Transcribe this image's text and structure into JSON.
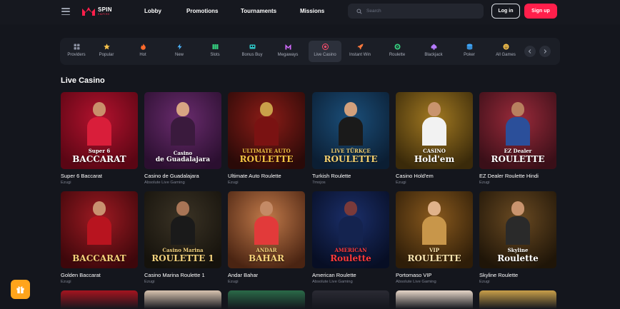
{
  "header": {
    "logo_text": "SPIN",
    "logo_subtext": "EMPIRE",
    "nav": [
      "Lobby",
      "Promotions",
      "Tournaments",
      "Missions"
    ],
    "search_placeholder": "Search",
    "login_label": "Log in",
    "signup_label": "Sign up"
  },
  "categories": [
    {
      "label": "Providers",
      "icon": "grid-icon",
      "color": "#8a90a0"
    },
    {
      "label": "Popular",
      "icon": "star-icon",
      "color": "#f5c04a"
    },
    {
      "label": "Hot",
      "icon": "fire-icon",
      "color": "#ff6a2b"
    },
    {
      "label": "New",
      "icon": "lightning-icon",
      "color": "#4db6ff"
    },
    {
      "label": "Slots",
      "icon": "slots-icon",
      "color": "#35d07f"
    },
    {
      "label": "Bonus Buy",
      "icon": "bonus-buy-icon",
      "color": "#2ec4c4"
    },
    {
      "label": "Megaways",
      "icon": "megaways-icon",
      "color": "#d36bff"
    },
    {
      "label": "Live Casino",
      "icon": "live-casino-icon",
      "color": "#ff4d6d",
      "active": true
    },
    {
      "label": "Instant Win",
      "icon": "rocket-icon",
      "color": "#ff7a3d"
    },
    {
      "label": "Roulette",
      "icon": "roulette-icon",
      "color": "#35d07f"
    },
    {
      "label": "Blackjack",
      "icon": "blackjack-icon",
      "color": "#b57bff"
    },
    {
      "label": "Poker",
      "icon": "poker-icon",
      "color": "#3fa9ff"
    },
    {
      "label": "All Games",
      "icon": "all-games-icon",
      "color": "#f5c04a"
    }
  ],
  "section_title": "Live Casino",
  "games": [
    {
      "title": "Super 6 Baccarat",
      "provider": "Ezugi",
      "logo_line1": "Super 6",
      "logo_line2": "BACCARAT",
      "bg": "#b3122e",
      "bg2": "#5a0614",
      "skin": "#c98f6b",
      "outfit": "#d91e3a",
      "logo_color": "#ffffff"
    },
    {
      "title": "Casino de Guadalajara",
      "provider": "Absolute Live Gaming",
      "logo_line1": "Casino",
      "logo_line2": "de Guadalajara",
      "bg": "#6a2c6e",
      "bg2": "#2b0f30",
      "skin": "#d7a583",
      "outfit": "#3a1a3d",
      "logo_color": "#ffffff"
    },
    {
      "title": "Ultimate Auto Roulette",
      "provider": "Ezugi",
      "logo_line1": "ULTIMATE AUTO",
      "logo_line2": "ROULETTE",
      "bg": "#8c1c17",
      "bg2": "#2a0a08",
      "skin": "#c9a04a",
      "outfit": "#7a1212",
      "logo_color": "#f6c443"
    },
    {
      "title": "Turkish Roulette",
      "provider": "7mojos",
      "logo_line1": "LIVE TÜRKÇE",
      "logo_line2": "ROULETTE",
      "bg": "#1b4f7a",
      "bg2": "#0b1e33",
      "skin": "#d2a07c",
      "outfit": "#1a1a1a",
      "logo_color": "#f4d06f"
    },
    {
      "title": "Casino Hold'em",
      "provider": "Ezugi",
      "logo_line1": "CASINO",
      "logo_line2": "Hold'em",
      "bg": "#a37a22",
      "bg2": "#3a2a0a",
      "skin": "#c9946e",
      "outfit": "#f2f2f2",
      "logo_color": "#ffffff"
    },
    {
      "title": "EZ Dealer Roulette Hindi",
      "provider": "Ezugi",
      "logo_line1": "EZ Dealer",
      "logo_line2": "ROULETTE",
      "bg": "#9a2a3a",
      "bg2": "#3a0f18",
      "skin": "#b8805f",
      "outfit": "#2b4f9a",
      "logo_color": "#ffffff"
    },
    {
      "title": "Golden Baccarat",
      "provider": "Ezugi",
      "logo_line1": "",
      "logo_line2": "BACCARAT",
      "bg": "#9e1a22",
      "bg2": "#3d070b",
      "skin": "#c99170",
      "outfit": "#b8141f",
      "logo_color": "#f6d27a"
    },
    {
      "title": "Casino Marina Roulette 1",
      "provider": "Ezugi",
      "logo_line1": "Casino Marina",
      "logo_line2": "ROULETTE 1",
      "bg": "#3b3325",
      "bg2": "#15120c",
      "skin": "#a87556",
      "outfit": "#1a1a1a",
      "logo_color": "#f3d27d"
    },
    {
      "title": "Andar Bahar",
      "provider": "Ezugi",
      "logo_line1": "ANDAR",
      "logo_line2": "BAHAR",
      "bg": "#c27a4a",
      "bg2": "#4a2412",
      "skin": "#c48a66",
      "outfit": "#e23a3a",
      "logo_color": "#f6d27a"
    },
    {
      "title": "American Roulette",
      "provider": "Absolute Live Gaming",
      "logo_line1": "AMERICAN",
      "logo_line2": "Roulette",
      "bg": "#1b2f6a",
      "bg2": "#070e24",
      "skin": "#7a3a3a",
      "outfit": "#14234f",
      "logo_color": "#ff3a3a"
    },
    {
      "title": "Portomaso VIP",
      "provider": "Absolute Live Gaming",
      "logo_line1": "VIP",
      "logo_line2": "ROULETTE",
      "bg": "#8a5a1e",
      "bg2": "#2e1d08",
      "skin": "#e0b28a",
      "outfit": "#c8964a",
      "logo_color": "#fbe6b0"
    },
    {
      "title": "Skyline Roulette",
      "provider": "Ezugi",
      "logo_line1": "Skyline",
      "logo_line2": "Roulette",
      "bg": "#6a4a22",
      "bg2": "#1f1508",
      "skin": "#c9946e",
      "outfit": "#2a2a2a",
      "logo_color": "#ffffff"
    }
  ],
  "partial_row_colors": [
    "#a5141f",
    "#d9c4b0",
    "#2a6a48",
    "#2a2a33",
    "#e6d6c8",
    "#c9a04a"
  ],
  "colors": {
    "accent": "#ff1f4b",
    "background": "#14161d",
    "gift": "#ffa41b"
  }
}
